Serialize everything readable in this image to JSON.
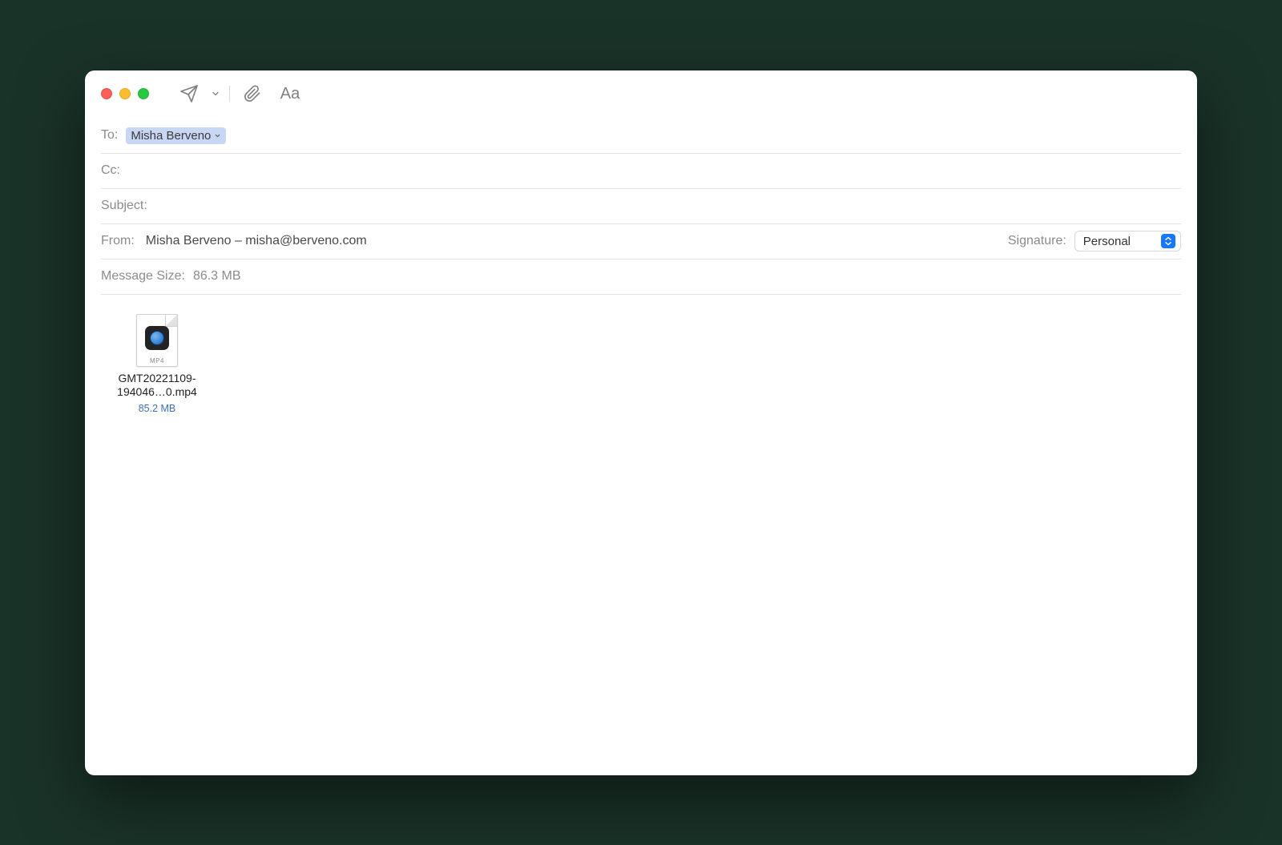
{
  "fields": {
    "to_label": "To:",
    "cc_label": "Cc:",
    "subject_label": "Subject:",
    "from_label": "From:",
    "signature_label": "Signature:",
    "message_size_label": "Message Size:"
  },
  "to_recipient": "Misha Berveno",
  "cc_value": "",
  "subject_value": "",
  "from_value": "Misha Berveno – misha@berveno.com",
  "signature_value": "Personal",
  "message_size": "86.3 MB",
  "attachment": {
    "extension": "MP4",
    "filename": "GMT20221109-194046…0.mp4",
    "size": "85.2 MB"
  },
  "toolbar": {
    "format_label": "Aa"
  }
}
